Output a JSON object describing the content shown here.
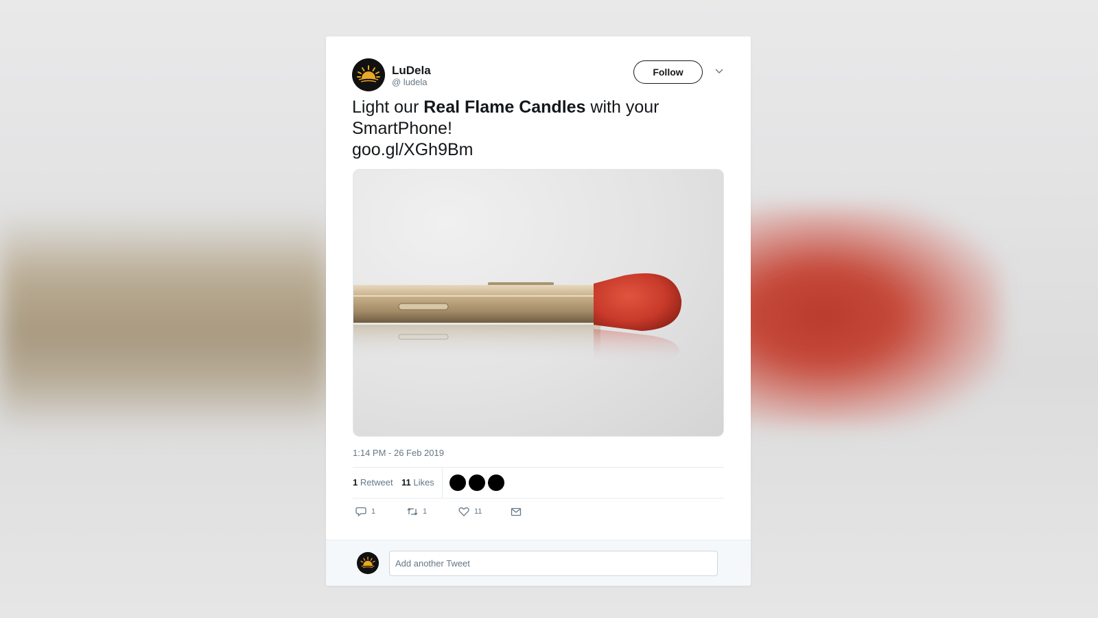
{
  "tweet": {
    "author_name": "LuDela",
    "author_handle": "@ ludela",
    "follow_label": "Follow",
    "text_before": "Light our ",
    "text_bold": "Real Flame Candles",
    "text_after": " with your SmartPhone!",
    "link": "goo.gl/XGh9Bm",
    "timestamp": "1:14 PM - 26 Feb 2019"
  },
  "stats": {
    "retweets_count": "1",
    "retweets_label": "Retweet",
    "likes_count": "11",
    "likes_label": "Likes"
  },
  "actions": {
    "reply_count": "1",
    "retweet_count": "1",
    "like_count": "11"
  },
  "reply": {
    "placeholder": "Add another Tweet"
  },
  "colors": {
    "avatar_sun": "#e9a727",
    "match_head": "#c83a2a",
    "phone_gold": "#c7b08a"
  },
  "icons": [
    "sun-logo-icon",
    "chevron-down-icon",
    "reply-icon",
    "retweet-icon",
    "heart-icon",
    "envelope-icon"
  ]
}
